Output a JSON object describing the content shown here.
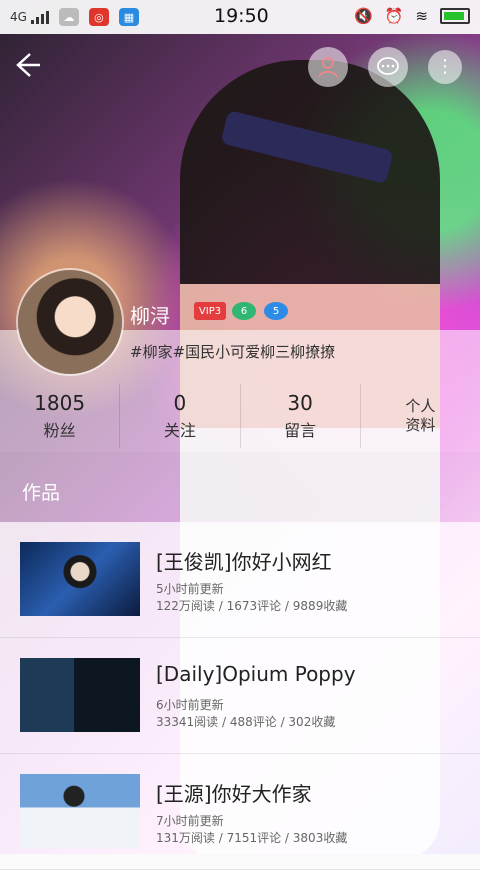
{
  "status": {
    "network": "4G",
    "time": "19:50"
  },
  "profile": {
    "name": "柳浔",
    "badges": [
      "VIP3",
      "6",
      "5"
    ],
    "tags": "#柳家#国民小可爱柳三柳撩撩"
  },
  "stats": [
    {
      "value": "1805",
      "label": "粉丝"
    },
    {
      "value": "0",
      "label": "关注"
    },
    {
      "value": "30",
      "label": "留言"
    },
    {
      "line1": "个人",
      "line2": "资料"
    }
  ],
  "section": {
    "title": "作品"
  },
  "works": [
    {
      "title": "[王俊凯]你好小网红",
      "time": "5小时前更新",
      "stats": "122万阅读 / 1673评论 / 9889收藏"
    },
    {
      "title": "[Daily]Opium Poppy",
      "time": "6小时前更新",
      "stats": "33341阅读 / 488评论 / 302收藏"
    },
    {
      "title": "[王源]你好大作家",
      "time": "7小时前更新",
      "stats": "131万阅读 / 7151评论 / 3803收藏"
    }
  ]
}
